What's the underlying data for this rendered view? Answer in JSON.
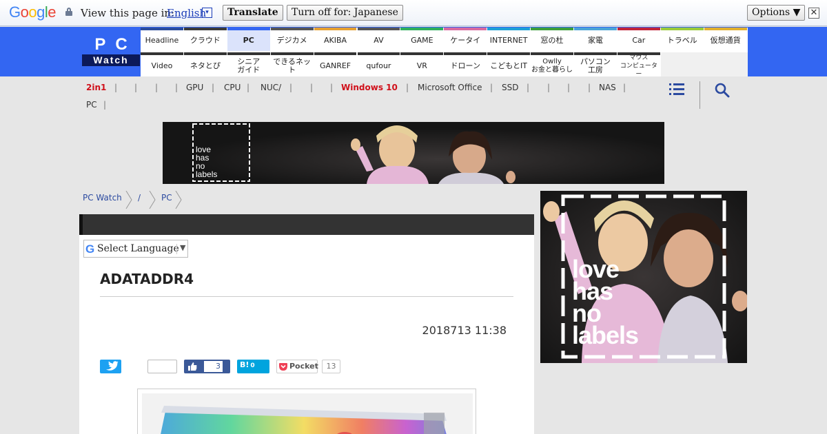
{
  "google_bar": {
    "logo": [
      "G",
      "o",
      "o",
      "g",
      "l",
      "e"
    ],
    "logo_colors": [
      "#4285f4",
      "#ea4335",
      "#fbbc05",
      "#4285f4",
      "#34a853",
      "#ea4335"
    ],
    "prompt": "View this page in:",
    "language": "English",
    "language_arrow": "▾",
    "translate_label": "Translate",
    "turn_off_label": "Turn off for: Japanese",
    "options_label": "Options ▼",
    "close_label": "✕"
  },
  "site": {
    "logo_top": "PC",
    "logo_bottom": "Watch",
    "brand_color": "#3366f2"
  },
  "nav_row1": [
    {
      "label": "Headline",
      "color": "#2a4c9c"
    },
    {
      "label": "クラウド",
      "color": "#3a3a3a"
    },
    {
      "label": "PC",
      "color": "#3366f2",
      "active": true
    },
    {
      "label": "デジカメ",
      "color": "#555555"
    },
    {
      "label": "AKIBA",
      "color": "#e5a033"
    },
    {
      "label": "AV",
      "color": "#555555"
    },
    {
      "label": "GAME",
      "color": "#2eaf5c"
    },
    {
      "label": "ケータイ",
      "color": "#d86aa0"
    },
    {
      "label": "INTERNET",
      "color": "#1d9fd6"
    },
    {
      "label": "窓の杜",
      "color": "#3c9e3c"
    },
    {
      "label": "家電",
      "color": "#4aa3d6"
    },
    {
      "label": "Car",
      "color": "#c0243a"
    },
    {
      "label": "トラベル",
      "color": "#9acb3a"
    },
    {
      "label": "仮想通貨",
      "color": "#e0b030"
    }
  ],
  "nav_row2": [
    {
      "label": "Video",
      "color": "#333333"
    },
    {
      "label": "ネタとぴ",
      "color": "#333333"
    },
    {
      "label": "シニア\nガイド",
      "color": "#333333"
    },
    {
      "label": "できるネット",
      "color": "#333333"
    },
    {
      "label": "GANREF",
      "color": "#333333"
    },
    {
      "label": "qufour",
      "color": "#333333"
    },
    {
      "label": "VR",
      "color": "#333333"
    },
    {
      "label": "ドローン",
      "color": "#333333"
    },
    {
      "label": "こどもとIT",
      "color": "#333333"
    },
    {
      "label": "Owlly\nお金と暮らし",
      "color": "#333333"
    },
    {
      "label": "パソコン\n工房",
      "color": "#333333"
    },
    {
      "label": "マウス\nコンピューター",
      "color": "#333333"
    }
  ],
  "subnav": {
    "row1": [
      "2in1",
      "",
      "",
      "",
      "GPU",
      "CPU",
      "NUC/",
      "",
      "",
      "Windows 10",
      "Microsoft Office",
      "SSD",
      "",
      "",
      "",
      "NAS"
    ],
    "row2": [
      "PC"
    ],
    "separator": "|"
  },
  "breadcrumb": [
    "PC Watch",
    "/",
    "PC"
  ],
  "translate_widget": {
    "label": "Select Language",
    "arrow": "▼",
    "g": "G"
  },
  "article": {
    "title": "ADATADDR4",
    "datetime": "2018713 11:38"
  },
  "social": {
    "facebook_count": "3",
    "hatena_label": "B!",
    "hatena_count": "0",
    "pocket_label": "Pocket",
    "pocket_count": "13"
  },
  "ads": {
    "label_line1": "love",
    "label_line2": "has",
    "label_line3": "no",
    "label_line4": "labels"
  }
}
